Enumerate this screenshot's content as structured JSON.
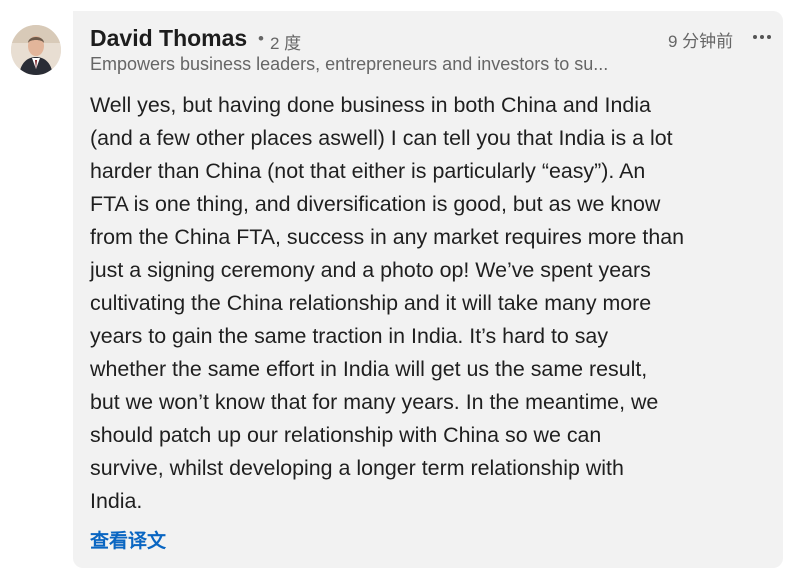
{
  "comment": {
    "author": "David Thomas",
    "separator": "•",
    "degree": "2 度",
    "time": "9 分钟前",
    "headline": "Empowers business leaders, entrepreneurs and investors to su...",
    "body_lines": [
      "Well yes, but having done business in both China and India",
      "(and a few other places aswell) I can tell you that India is a lot",
      "harder than China (not that either is particularly “easy”). An",
      "FTA is one thing, and diversification is good, but as we know",
      "from the China FTA, success in any market requires more than",
      "just a signing ceremony and a photo op! We’ve spent years",
      "cultivating the China relationship and it will take many more",
      "years to gain the same traction in India. It’s hard to say",
      "whether the same effort in India will get us the same result,",
      "but we won’t know that for many years. In the meantime, we",
      "should patch up our relationship with China so we can",
      "survive, whilst developing a longer term relationship with",
      "India."
    ],
    "translate_label": "查看译文",
    "icons": {
      "more": "more-horizontal-icon",
      "avatar": "profile-photo"
    }
  },
  "colors": {
    "card_background": "#f2f2f2",
    "link": "#0a66c2",
    "text": "#1f1f1f",
    "muted": "#666666"
  }
}
